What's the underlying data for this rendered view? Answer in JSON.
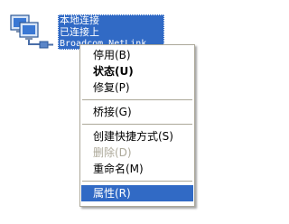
{
  "connection": {
    "icon": "network-connection-icon",
    "name": "本地连接",
    "status": "已连接上",
    "device": "Broadcom NetLink..."
  },
  "context_menu": {
    "items": [
      {
        "label": "停用(B)",
        "type": "item"
      },
      {
        "label": "状态(U)",
        "type": "item",
        "bold": true
      },
      {
        "label": "修复(P)",
        "type": "item"
      },
      {
        "type": "separator"
      },
      {
        "label": "桥接(G)",
        "type": "item"
      },
      {
        "type": "separator"
      },
      {
        "label": "创建快捷方式(S)",
        "type": "item"
      },
      {
        "label": "删除(D)",
        "type": "item",
        "disabled": true
      },
      {
        "label": "重命名(M)",
        "type": "item"
      },
      {
        "type": "separator"
      },
      {
        "label": "属性(R)",
        "type": "item",
        "selected": true
      }
    ]
  },
  "colors": {
    "highlight": "#316ac5",
    "disabled_text": "#aca899",
    "menu_border": "#aca899"
  }
}
